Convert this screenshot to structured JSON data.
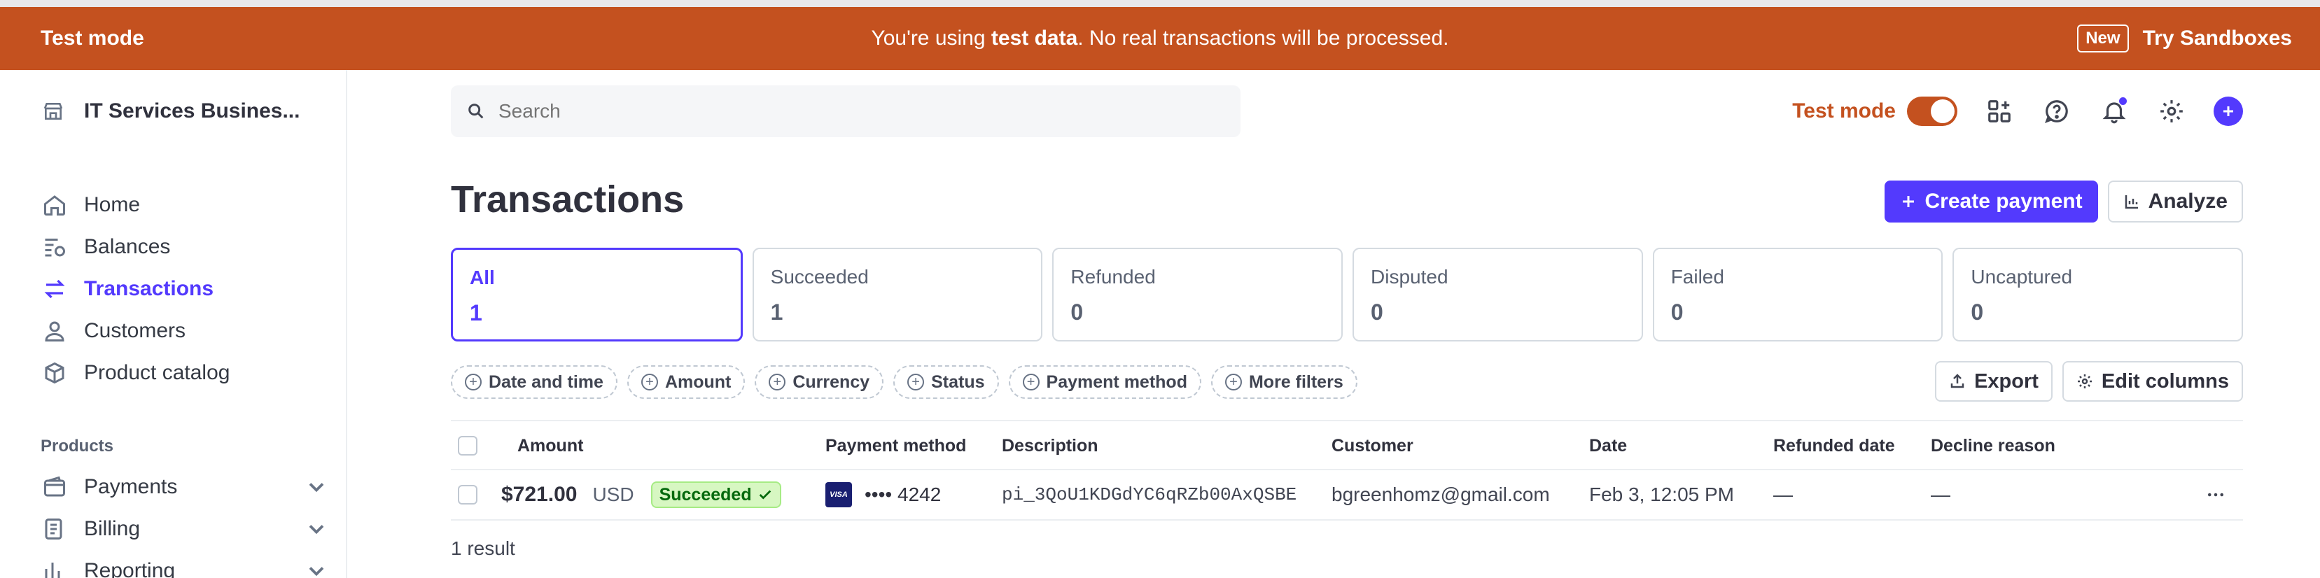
{
  "banner": {
    "left": "Test mode",
    "message_pre": "You're using ",
    "message_bold": "test data",
    "message_post": ". No real transactions will be processed.",
    "new_badge": "New",
    "try_link": "Try Sandboxes",
    "color": "#c4511f"
  },
  "sidebar": {
    "account_name": "IT Services Busines...",
    "nav": [
      {
        "label": "Home",
        "icon": "home-icon"
      },
      {
        "label": "Balances",
        "icon": "balances-icon"
      },
      {
        "label": "Transactions",
        "icon": "transactions-icon",
        "active": true
      },
      {
        "label": "Customers",
        "icon": "person-icon"
      },
      {
        "label": "Product catalog",
        "icon": "box-icon"
      }
    ],
    "section_label": "Products",
    "products": [
      {
        "label": "Payments",
        "icon": "wallet-icon"
      },
      {
        "label": "Billing",
        "icon": "billing-icon"
      },
      {
        "label": "Reporting",
        "icon": "chart-icon"
      }
    ]
  },
  "search": {
    "placeholder": "Search"
  },
  "topbar": {
    "test_mode_label": "Test mode",
    "test_mode_on": true
  },
  "page": {
    "title": "Transactions",
    "create_payment": "Create payment",
    "analyze": "Analyze"
  },
  "tabs": [
    {
      "label": "All",
      "count": "1",
      "active": true
    },
    {
      "label": "Succeeded",
      "count": "1"
    },
    {
      "label": "Refunded",
      "count": "0"
    },
    {
      "label": "Disputed",
      "count": "0"
    },
    {
      "label": "Failed",
      "count": "0"
    },
    {
      "label": "Uncaptured",
      "count": "0"
    }
  ],
  "filters": [
    "Date and time",
    "Amount",
    "Currency",
    "Status",
    "Payment method",
    "More filters"
  ],
  "table_actions": {
    "export": "Export",
    "edit_columns": "Edit columns"
  },
  "table": {
    "columns": [
      "Amount",
      "Payment method",
      "Description",
      "Customer",
      "Date",
      "Refunded date",
      "Decline reason"
    ],
    "rows": [
      {
        "amount": "$721.00",
        "currency": "USD",
        "status": "Succeeded",
        "card_brand": "VISA",
        "last4": "•••• 4242",
        "description": "pi_3QoU1KDGdYC6qRZb00AxQSBE",
        "customer": "bgreenhomz@gmail.com",
        "date": "Feb 3, 12:05 PM",
        "refunded_date": "—",
        "decline_reason": "—"
      }
    ]
  },
  "result_count": "1 result",
  "accent": "#533afd"
}
